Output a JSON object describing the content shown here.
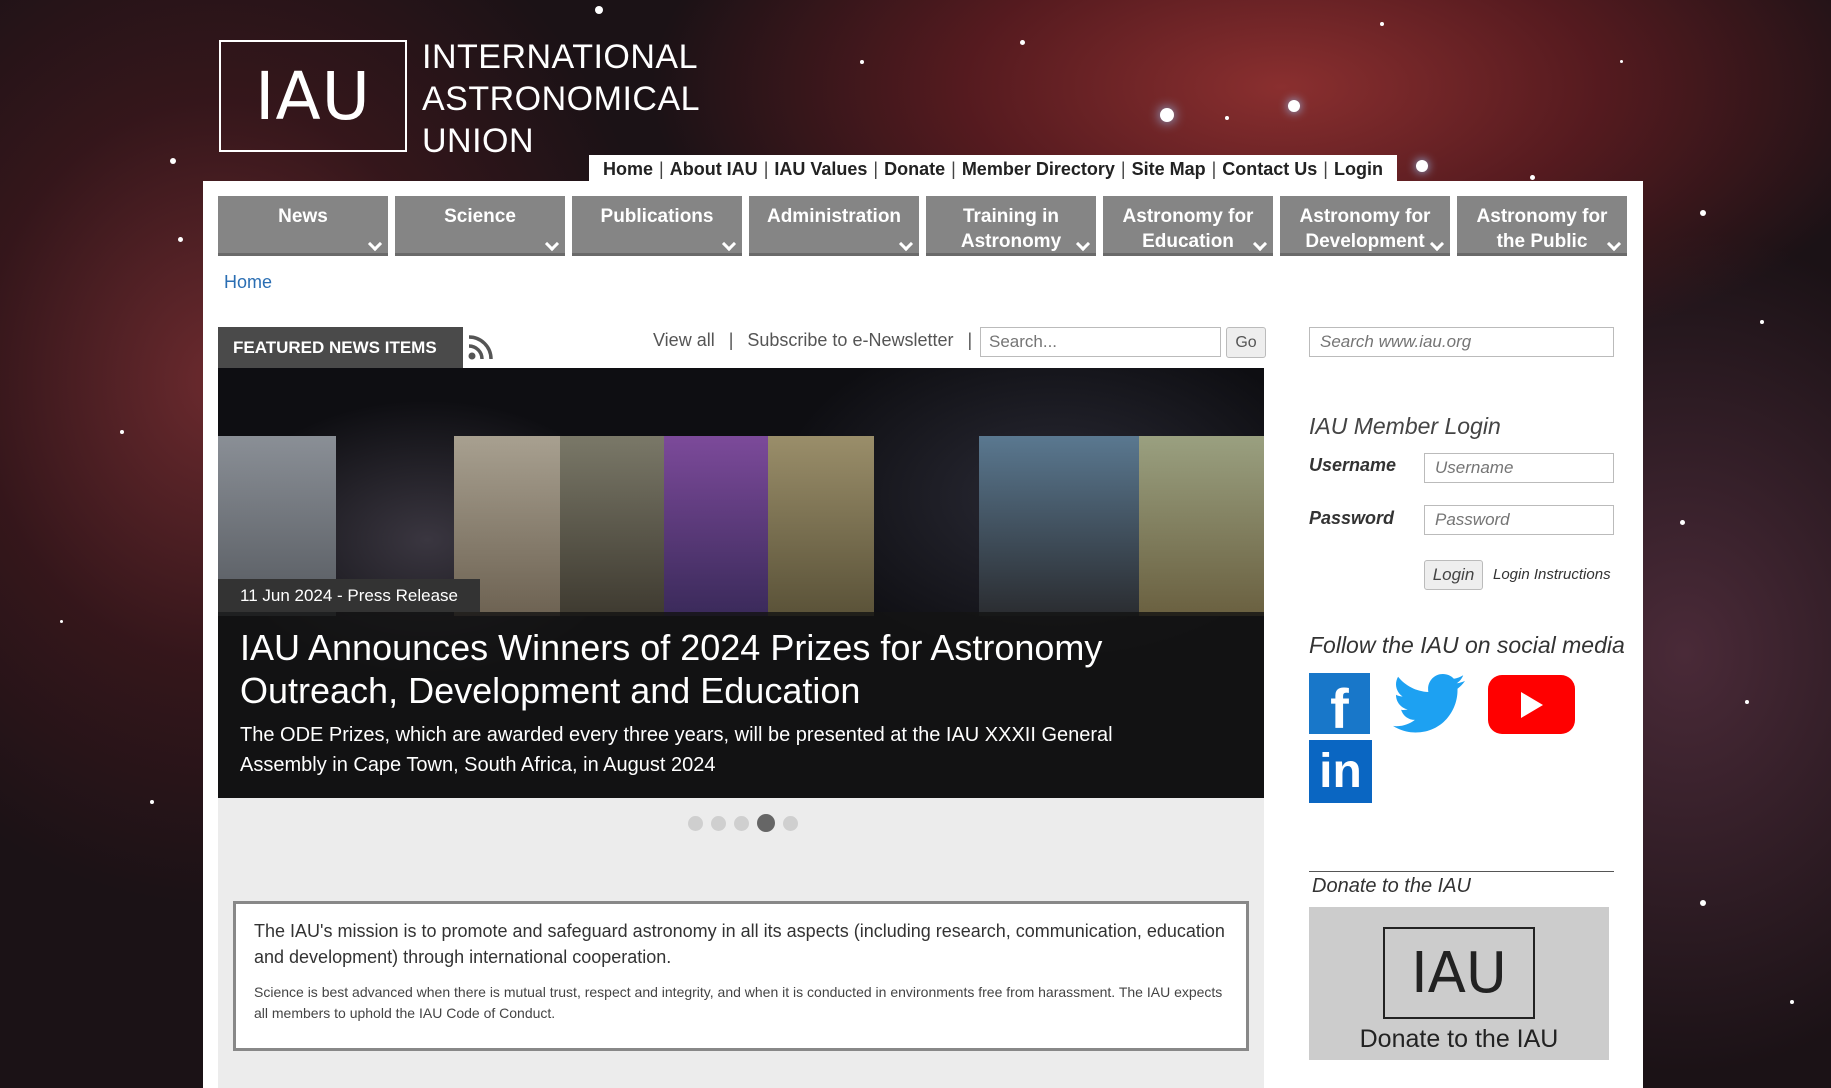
{
  "header": {
    "logo_text": "IAU",
    "org_line1": "INTERNATIONAL",
    "org_line2": "ASTRONOMICAL",
    "org_line3": "UNION"
  },
  "top_links": [
    "Home",
    "About IAU",
    "IAU Values",
    "Donate",
    "Member Directory",
    "Site Map",
    "Contact Us",
    "Login"
  ],
  "nav": [
    {
      "line1": "News",
      "line2": ""
    },
    {
      "line1": "Science",
      "line2": ""
    },
    {
      "line1": "Publications",
      "line2": ""
    },
    {
      "line1": "Administration",
      "line2": ""
    },
    {
      "line1": "Training in",
      "line2": "Astronomy"
    },
    {
      "line1": "Astronomy for",
      "line2": "Education"
    },
    {
      "line1": "Astronomy for",
      "line2": "Development"
    },
    {
      "line1": "Astronomy for",
      "line2": "the Public"
    }
  ],
  "breadcrumb": "Home",
  "featured": {
    "tab_label": "FEATURED NEWS ITEMS",
    "view_all": "View all",
    "separator": "|",
    "subscribe": "Subscribe to e-Newsletter",
    "search_placeholder": "Search...",
    "go_label": "Go"
  },
  "slide": {
    "date_tag": "11 Jun 2024 - Press Release",
    "title_line1": "IAU Announces Winners of 2024 Prizes for Astronomy",
    "title_line2": "Outreach, Development and Education",
    "subtitle_line1": "The ODE Prizes, which are awarded every three years, will be presented at the IAU XXXII General",
    "subtitle_line2": "Assembly in Cape Town, South Africa, in August 2024",
    "dots_total": 5,
    "active_dot": 4
  },
  "mission": {
    "main": "The IAU's mission is to promote and safeguard astronomy in all its aspects (including research, communication, education and development) through international cooperation.",
    "sub": "Science is best advanced when there is mutual trust, respect and integrity, and when it is conducted in environments free from harassment. The IAU expects all members to uphold the IAU Code of Conduct."
  },
  "sidebar": {
    "site_search_placeholder": "Search www.iau.org",
    "login_title": "IAU Member Login",
    "username_label": "Username",
    "username_placeholder": "Username",
    "password_label": "Password",
    "password_placeholder": "Password",
    "login_button": "Login",
    "login_instructions": "Login Instructions",
    "follow_title": "Follow the IAU on social media",
    "social": [
      "facebook-icon",
      "twitter-icon",
      "youtube-icon",
      "linkedin-icon"
    ],
    "donate_title": "Donate to the IAU",
    "donate_logo": "IAU",
    "donate_label": "Donate to the IAU"
  },
  "colors": {
    "nav_bg": "#858585",
    "link_blue": "#2a6eb3",
    "facebook": "#1877c9",
    "twitter": "#1da1f2",
    "youtube": "#ff0000",
    "linkedin": "#0a66c2"
  }
}
